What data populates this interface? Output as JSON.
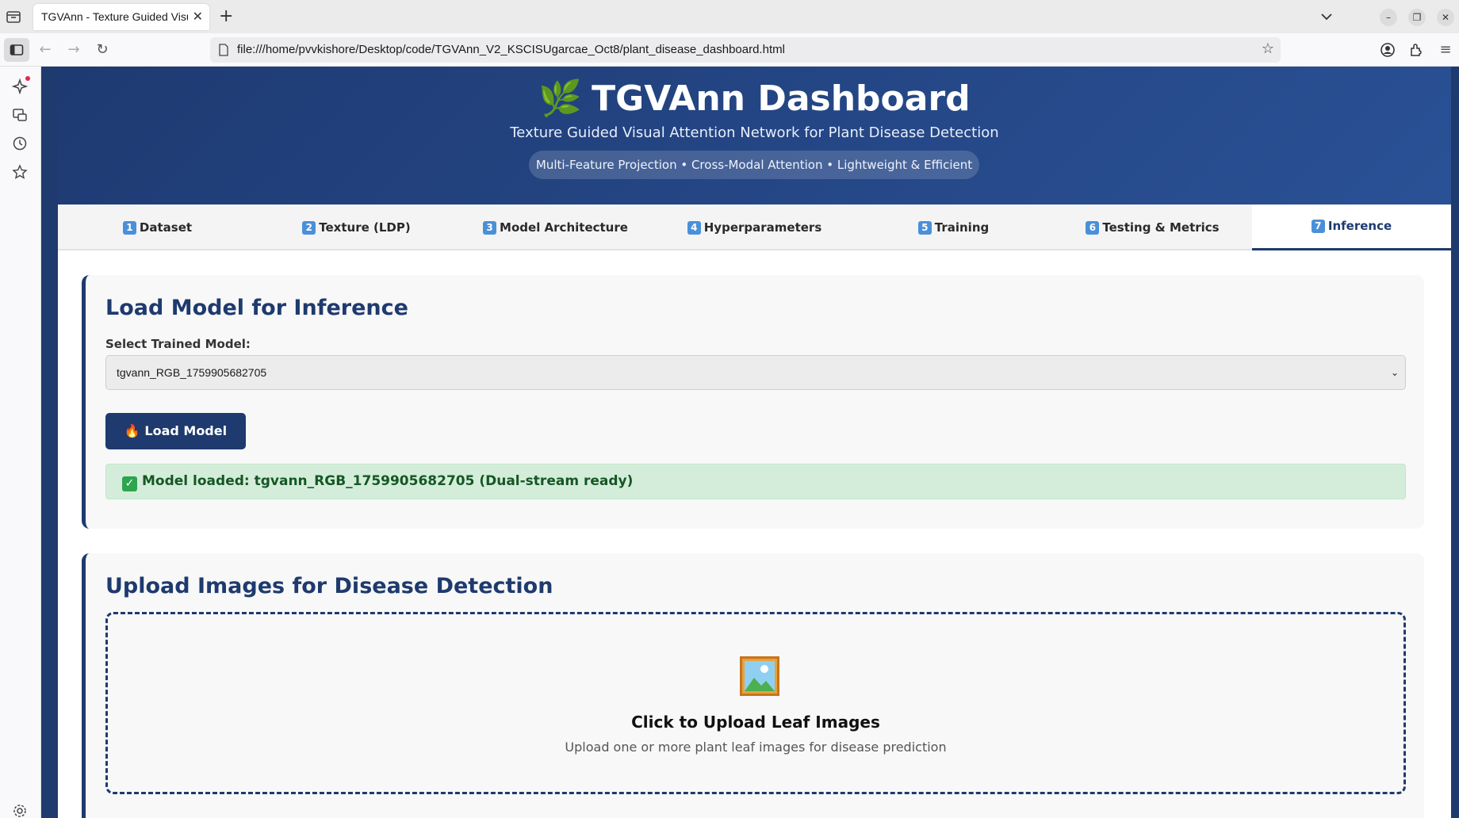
{
  "browser": {
    "tab_title": "TGVAnn - Texture Guided Visual Attention Network",
    "url": "file:///home/pvvkishore/Desktop/code/TGVAnn_V2_KSCISUgarcae_Oct8/plant_disease_dashboard.html"
  },
  "header": {
    "title": "TGVAnn Dashboard",
    "subtitle": "Texture Guided Visual Attention Network for Plant Disease Detection",
    "badge": "Multi-Feature Projection • Cross-Modal Attention • Lightweight & Efficient"
  },
  "tabs": [
    {
      "num": "1",
      "label": "Dataset"
    },
    {
      "num": "2",
      "label": "Texture (LDP)"
    },
    {
      "num": "3",
      "label": "Model Architecture"
    },
    {
      "num": "4",
      "label": "Hyperparameters"
    },
    {
      "num": "5",
      "label": "Training"
    },
    {
      "num": "6",
      "label": "Testing & Metrics"
    },
    {
      "num": "7",
      "label": "Inference"
    }
  ],
  "load_section": {
    "title": "Load Model for Inference",
    "select_label": "Select Trained Model:",
    "selected_model": "tgvann_RGB_1759905682705",
    "button_label": "🔥 Load Model",
    "status": "Model loaded: tgvann_RGB_1759905682705 (Dual-stream ready)"
  },
  "upload_section": {
    "title": "Upload Images for Disease Detection",
    "zone_title": "Click to Upload Leaf Images",
    "zone_subtitle": "Upload one or more plant leaf images for disease prediction"
  },
  "colors": {
    "primary": "#1e3a6e",
    "success_bg": "#d4edda",
    "success_text": "#155724",
    "green_button": "#28a745"
  }
}
